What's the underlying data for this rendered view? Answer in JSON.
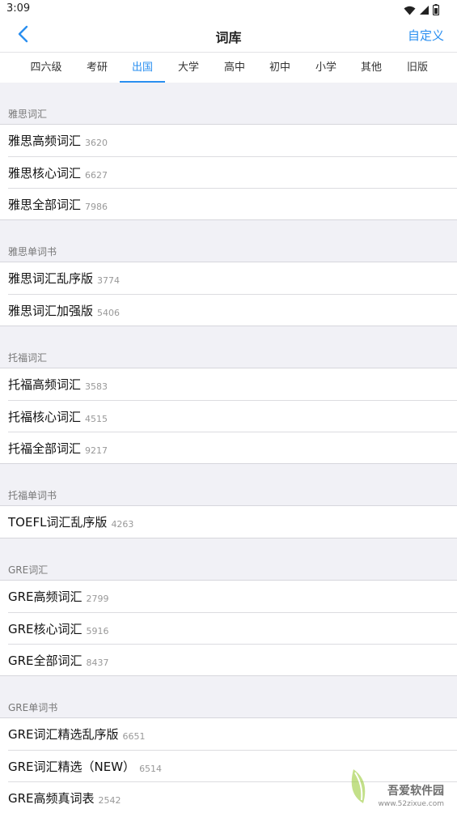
{
  "status_bar": {
    "time": "3:09"
  },
  "header": {
    "title": "词库",
    "custom_label": "自定义"
  },
  "colors": {
    "accent": "#2a8ff0",
    "background": "#f1f1f6"
  },
  "icons": {
    "back": "chevron-left-icon",
    "wifi": "wifi-icon",
    "signal": "signal-icon",
    "battery": "battery-icon"
  },
  "tabs": [
    {
      "label": "四六级",
      "active": false
    },
    {
      "label": "考研",
      "active": false
    },
    {
      "label": "出国",
      "active": true
    },
    {
      "label": "大学",
      "active": false
    },
    {
      "label": "高中",
      "active": false
    },
    {
      "label": "初中",
      "active": false
    },
    {
      "label": "小学",
      "active": false
    },
    {
      "label": "其他",
      "active": false
    },
    {
      "label": "旧版",
      "active": false
    }
  ],
  "sections": [
    {
      "title": "雅思词汇",
      "items": [
        {
          "name": "雅思高频词汇",
          "count": "3620"
        },
        {
          "name": "雅思核心词汇",
          "count": "6627"
        },
        {
          "name": "雅思全部词汇",
          "count": "7986"
        }
      ]
    },
    {
      "title": "雅思单词书",
      "items": [
        {
          "name": "雅思词汇乱序版",
          "count": "3774"
        },
        {
          "name": "雅思词汇加强版",
          "count": "5406"
        }
      ]
    },
    {
      "title": "托福词汇",
      "items": [
        {
          "name": "托福高频词汇",
          "count": "3583"
        },
        {
          "name": "托福核心词汇",
          "count": "4515"
        },
        {
          "name": "托福全部词汇",
          "count": "9217"
        }
      ]
    },
    {
      "title": "托福单词书",
      "items": [
        {
          "name": "TOEFL词汇乱序版",
          "count": "4263"
        }
      ]
    },
    {
      "title": "GRE词汇",
      "items": [
        {
          "name": "GRE高频词汇",
          "count": "2799"
        },
        {
          "name": "GRE核心词汇",
          "count": "5916"
        },
        {
          "name": "GRE全部词汇",
          "count": "8437"
        }
      ]
    },
    {
      "title": "GRE单词书",
      "items": [
        {
          "name": "GRE词汇精选乱序版",
          "count": "6651"
        },
        {
          "name": "GRE词汇精选（NEW）",
          "count": "6514"
        },
        {
          "name": "GRE高频真词表",
          "count": "2542"
        }
      ]
    }
  ],
  "watermark": {
    "text": "吾爱软件园",
    "url": "www.52zixue.com"
  }
}
